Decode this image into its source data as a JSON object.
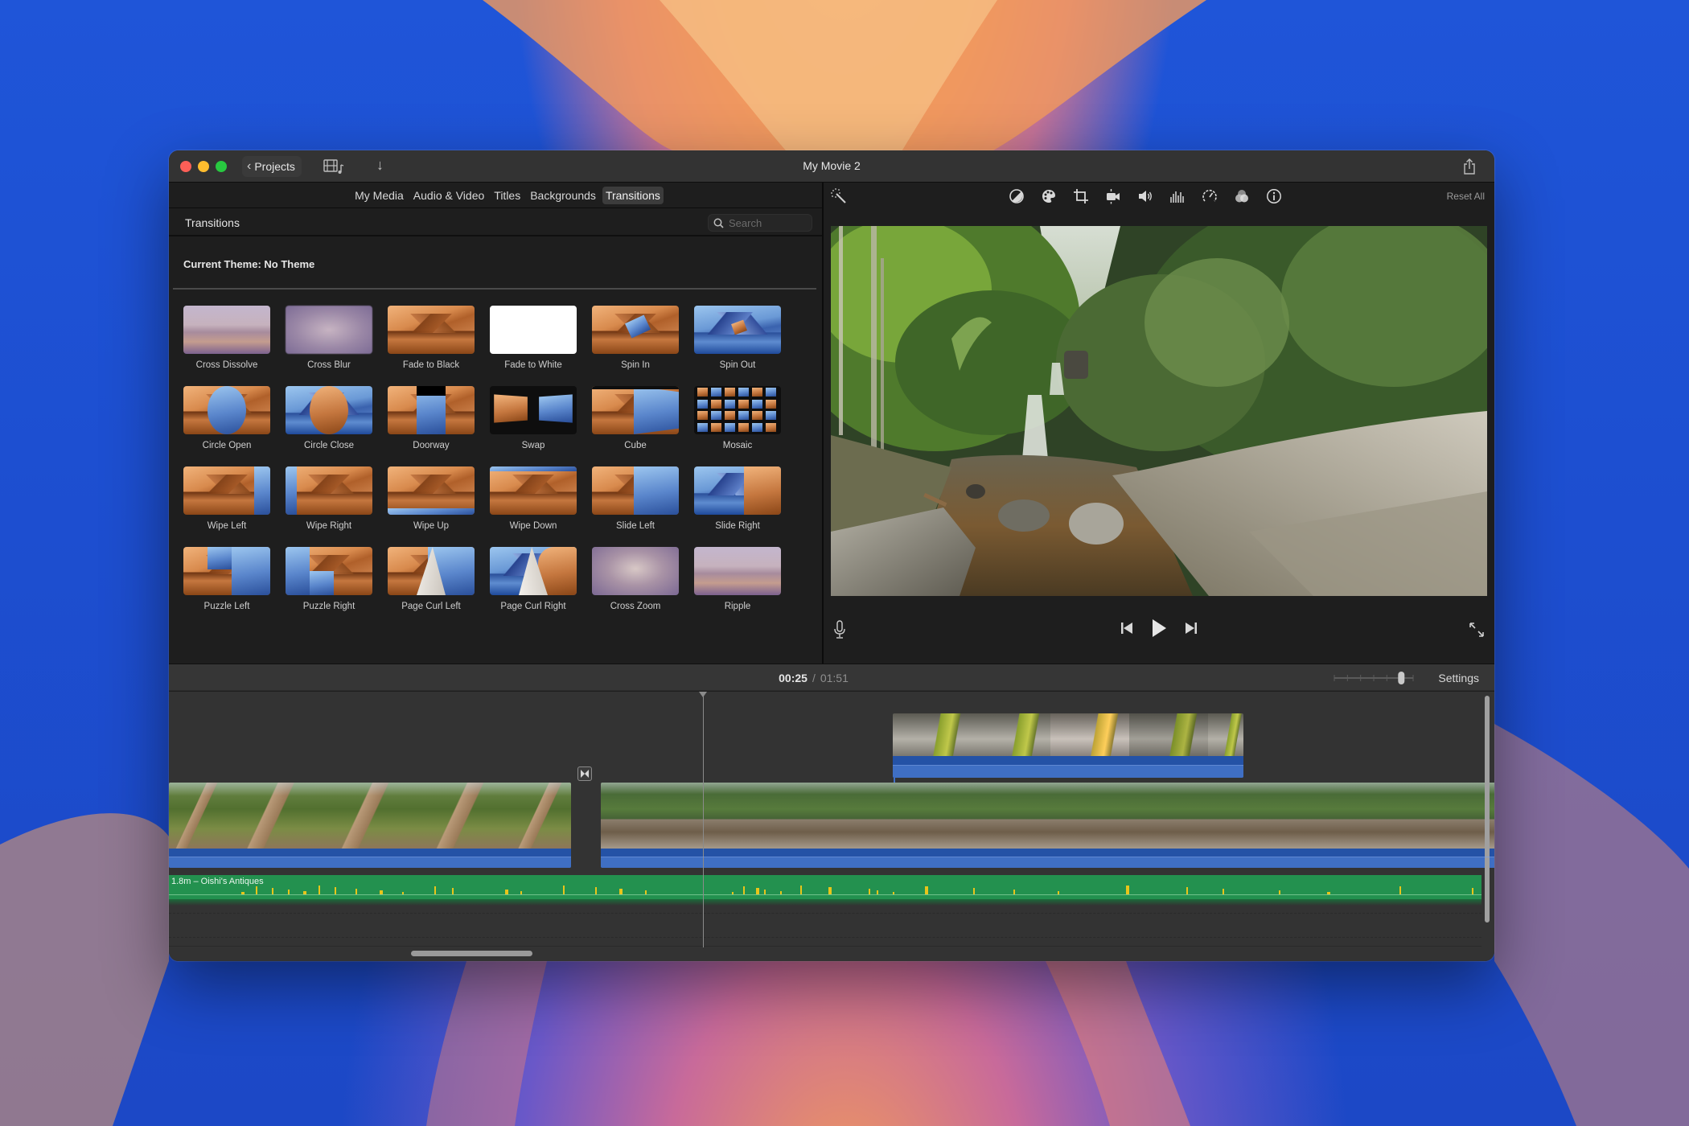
{
  "window": {
    "title": "My Movie 2",
    "back_label": "Projects"
  },
  "browser": {
    "tabs": [
      {
        "label": "My Media",
        "active": false
      },
      {
        "label": "Audio & Video",
        "active": false
      },
      {
        "label": "Titles",
        "active": false
      },
      {
        "label": "Backgrounds",
        "active": false
      },
      {
        "label": "Transitions",
        "active": true
      }
    ],
    "section_title": "Transitions",
    "search": {
      "value": "",
      "placeholder": "Search"
    },
    "theme_label": "Current Theme: No Theme",
    "transitions": [
      {
        "label": "Cross Dissolve",
        "style": "haze"
      },
      {
        "label": "Cross Blur",
        "style": "blur"
      },
      {
        "label": "Fade to Black",
        "style": "orange"
      },
      {
        "label": "Fade to White",
        "style": "white"
      },
      {
        "label": "Spin In",
        "style": "orange"
      },
      {
        "label": "Spin Out",
        "style": "blue"
      },
      {
        "label": "Circle Open",
        "style": "orange"
      },
      {
        "label": "Circle Close",
        "style": "blue"
      },
      {
        "label": "Doorway",
        "style": "orange"
      },
      {
        "label": "Swap",
        "style": "dark"
      },
      {
        "label": "Cube",
        "style": "orange"
      },
      {
        "label": "Mosaic",
        "style": "dark"
      },
      {
        "label": "Wipe Left",
        "style": "orange"
      },
      {
        "label": "Wipe Right",
        "style": "orange"
      },
      {
        "label": "Wipe Up",
        "style": "orange"
      },
      {
        "label": "Wipe Down",
        "style": "orange"
      },
      {
        "label": "Slide Left",
        "style": "orange"
      },
      {
        "label": "Slide Right",
        "style": "blue"
      },
      {
        "label": "Puzzle Left",
        "style": "orange"
      },
      {
        "label": "Puzzle Right",
        "style": "blue"
      },
      {
        "label": "Page Curl Left",
        "style": "orange"
      },
      {
        "label": "Page Curl Right",
        "style": "blue"
      },
      {
        "label": "Cross Zoom",
        "style": "zoom"
      },
      {
        "label": "Ripple",
        "style": "haze"
      }
    ]
  },
  "viewer": {
    "tools": [
      "color-balance-icon",
      "color-correction-icon",
      "crop-icon",
      "stabilization-icon",
      "volume-icon",
      "noise-reduction-icon",
      "speed-icon",
      "clip-filter-icon",
      "info-icon"
    ],
    "reset_label": "Reset All"
  },
  "timeline": {
    "current_time": "00:25",
    "separator": "/",
    "total_time": "01:51",
    "settings_label": "Settings",
    "zoom_level": 0.85,
    "music_clip_label": "1.8m – Oishi's Antiques"
  },
  "colors": {
    "video_clip_audio": "#2452a6",
    "music_track": "#23914f",
    "waveform_peak": "#e8c51a",
    "active_tab_bg": "#3c3c3c"
  }
}
